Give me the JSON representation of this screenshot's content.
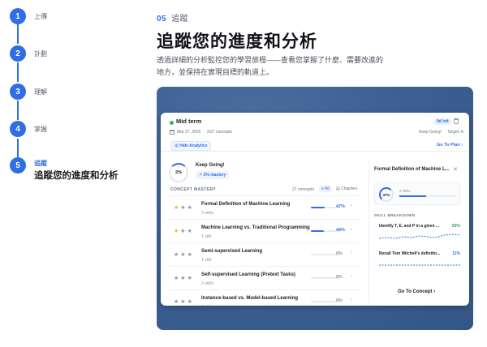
{
  "stepper": {
    "steps": [
      {
        "num": "1",
        "label": "上傳"
      },
      {
        "num": "2",
        "label": "計劃"
      },
      {
        "num": "3",
        "label": "理解"
      },
      {
        "num": "4",
        "label": "掌握"
      },
      {
        "num": "5",
        "label": "追蹤",
        "sub": "追蹤您的進度和分析"
      }
    ]
  },
  "heading": {
    "number": "05",
    "eyebrow": "追蹤",
    "title": "追蹤您的進度和分析",
    "description": "透過詳細的分析監控您的學習旅程——查看您掌握了什麼、需要改進的地方，並保持在實現目標的軌道上。"
  },
  "card": {
    "title": "Mid term",
    "days_left": "9d left",
    "date": "Mar 27, 2026",
    "concepts_meta": "2/27 concepts",
    "keep_going_meta": "Keep Going!",
    "target_meta": "Target: A",
    "hide_analytics": "Hide Analytics",
    "go_to_plan": "Go To Plan",
    "progress_pct": "2%",
    "progress_value": 0.02,
    "keep_going_title": "Keep Going!",
    "mastery_label": "2% mastery",
    "section_label": "CONCEPT MASTERY",
    "concepts_count": "27 concepts",
    "filter_all": "All",
    "filter_chapters": "Chapters",
    "rows": [
      {
        "title": "Formal Definition of Machine Learning",
        "sub": "2 skills",
        "pct": "47%",
        "value": 0.47,
        "gold_stars": 1
      },
      {
        "title": "Machine Learning vs. Traditional Programming",
        "sub": "1 skill",
        "pct": "44%",
        "value": 0.44,
        "gold_stars": 1
      },
      {
        "title": "Semi-supervised Learning",
        "sub": "1 skill",
        "pct": "0%",
        "value": 0,
        "gold_stars": 0
      },
      {
        "title": "Self-supervised Learning (Pretext Tasks)",
        "sub": "2 skills",
        "pct": "0%",
        "value": 0,
        "gold_stars": 0
      },
      {
        "title": "Instance-based vs. Model-based Learning",
        "sub": "2 skills",
        "pct": "0%",
        "value": 0,
        "gold_stars": 0
      }
    ],
    "detail": {
      "title": "Formal Definition of Machine L...",
      "gauge_pct": "47%",
      "gauge_value": 0.47,
      "skills": "2 skills",
      "breakdown_label": "SKILL BREAKDOWN",
      "skills_list": [
        {
          "name": "Identify T, E, and P in a given ...",
          "pct": "83%",
          "color": "#2aa56a"
        },
        {
          "name": "Recall Tom Mitchell's definitio...",
          "pct": "11%",
          "color": "#2f6ee6"
        }
      ],
      "go_to_concept": "Go To Concept"
    }
  }
}
